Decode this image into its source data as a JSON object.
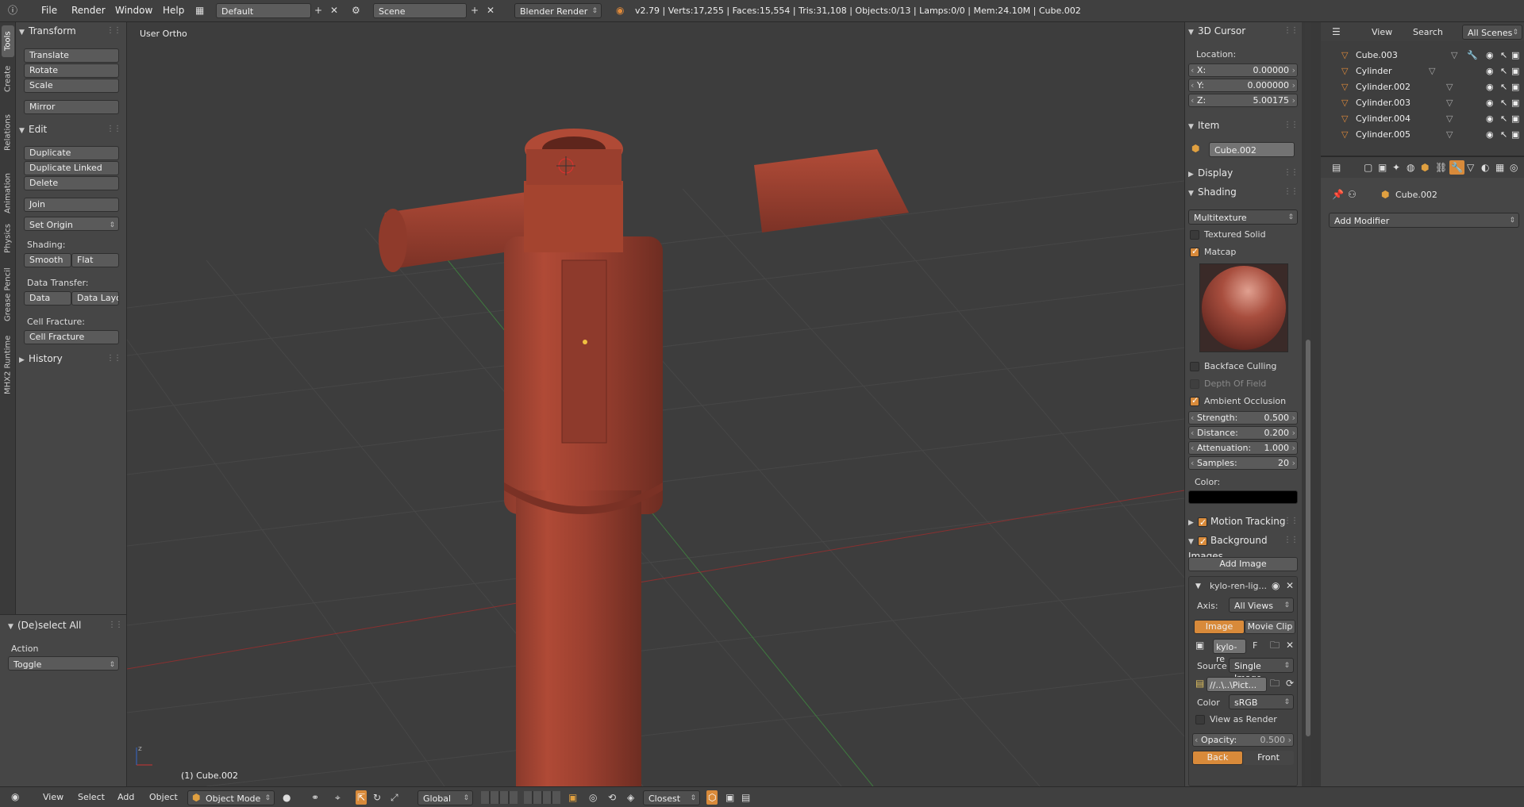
{
  "topbar": {
    "menus": [
      "File",
      "Render",
      "Window",
      "Help"
    ],
    "layout": "Default",
    "scene": "Scene",
    "engine": "Blender Render",
    "stats": "v2.79 | Verts:17,255 | Faces:15,554 | Tris:31,108 | Objects:0/13 | Lamps:0/0 | Mem:24.10M | Cube.002"
  },
  "tabs": [
    "Tools",
    "Create",
    "Relations",
    "Animation",
    "Physics",
    "Grease Pencil",
    "MHX2 Runtime"
  ],
  "toolshelf": {
    "transform_header": "Transform",
    "translate": "Translate",
    "rotate": "Rotate",
    "scale": "Scale",
    "mirror": "Mirror",
    "edit_header": "Edit",
    "duplicate": "Duplicate",
    "duplicate_linked": "Duplicate Linked",
    "delete": "Delete",
    "join": "Join",
    "set_origin": "Set Origin",
    "shading_label": "Shading:",
    "smooth": "Smooth",
    "flat": "Flat",
    "data_transfer_label": "Data Transfer:",
    "data": "Data",
    "data_layo": "Data Layo",
    "cell_fracture_label": "Cell Fracture:",
    "cell_fracture": "Cell Fracture",
    "history_header": "History",
    "deselect_header": "(De)select All",
    "action_label": "Action",
    "action_value": "Toggle"
  },
  "viewport": {
    "view_name": "User Ortho",
    "object_label": "(1) Cube.002"
  },
  "npanel": {
    "cursor_header": "3D Cursor",
    "location_label": "Location:",
    "x_label": "X:",
    "x_value": "0.00000",
    "y_label": "Y:",
    "y_value": "0.000000",
    "z_label": "Z:",
    "z_value": "5.00175",
    "item_header": "Item",
    "item_name": "Cube.002",
    "display_header": "Display",
    "shading_header": "Shading",
    "shading_mode": "Multitexture",
    "textured_solid": "Textured Solid",
    "matcap": "Matcap",
    "backface_culling": "Backface Culling",
    "depth_of_field": "Depth Of Field",
    "ambient_occlusion": "Ambient Occlusion",
    "strength_label": "Strength:",
    "strength_value": "0.500",
    "distance_label": "Distance:",
    "distance_value": "0.200",
    "attenuation_label": "Attenuation:",
    "attenuation_value": "1.000",
    "samples_label": "Samples:",
    "samples_value": "20",
    "color_label": "Color:",
    "motion_tracking": "Motion Tracking",
    "background_images": "Background Images",
    "add_image": "Add Image",
    "bg_name": "kylo-ren-lig...",
    "axis_label": "Axis:",
    "axis_value": "All Views",
    "image_tab": "Image",
    "movie_clip_tab": "Movie Clip",
    "image_field": "kylo-re",
    "f_label": "F",
    "source_label": "Source",
    "source_value": "Single Image",
    "path_value": "//..\\..\\Pict...",
    "color_space_label": "Color",
    "color_space_value": "sRGB",
    "view_as_render": "View as Render",
    "opacity_label": "Opacity:",
    "opacity_value": "0.500",
    "back": "Back",
    "front": "Front"
  },
  "outliner": {
    "view": "View",
    "search": "Search",
    "all_scenes": "All Scenes",
    "rows": [
      "Cube.003",
      "Cylinder",
      "Cylinder.002",
      "Cylinder.003",
      "Cylinder.004",
      "Cylinder.005"
    ]
  },
  "properties": {
    "object_name": "Cube.002",
    "add_modifier": "Add Modifier"
  },
  "bottombar": {
    "view": "View",
    "select": "Select",
    "add": "Add",
    "object": "Object",
    "mode": "Object Mode",
    "orientation": "Global",
    "snap": "Closest"
  }
}
